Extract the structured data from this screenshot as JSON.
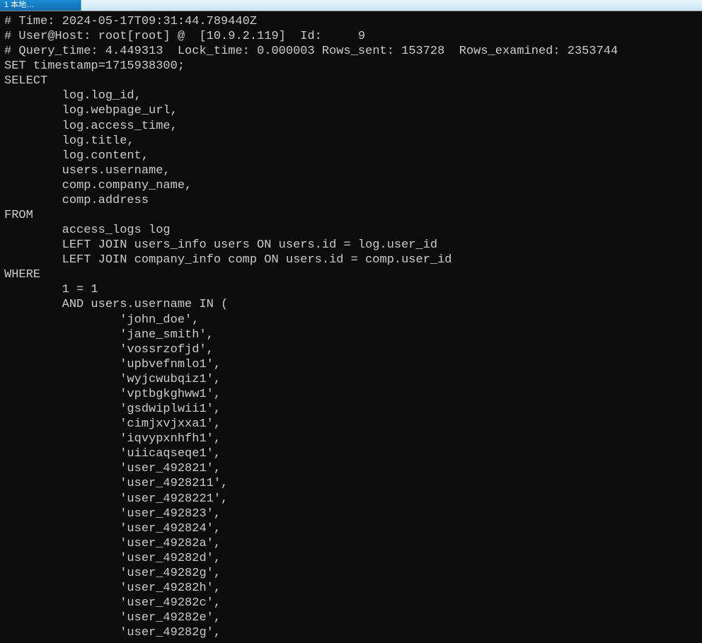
{
  "titlebar": {
    "label": "1 本地…"
  },
  "log": {
    "time_prefix": "# Time: ",
    "time_value": "2024-05-17T09:31:44.789440Z",
    "userhost_prefix": "# User@Host: ",
    "userhost_value": "root[root] @  [10.9.2.119]  Id:     9",
    "query_prefix": "# Query_time: ",
    "query_time": "4.449313",
    "lock_label": "  Lock_time: ",
    "lock_time": "0.000003",
    "rows_sent_label": " Rows_sent: ",
    "rows_sent": "153728",
    "rows_examined_label": "  Rows_examined: ",
    "rows_examined": "2353744",
    "set_stmt": "SET timestamp=1715938300;",
    "select_kw": "SELECT",
    "cols": [
      "        log.log_id,",
      "        log.webpage_url,",
      "        log.access_time,",
      "        log.title,",
      "        log.content,",
      "        users.username,",
      "        comp.company_name,",
      "        comp.address"
    ],
    "from_kw": "FROM",
    "from_lines": [
      "        access_logs log",
      "        LEFT JOIN users_info users ON users.id = log.user_id",
      "        LEFT JOIN company_info comp ON users.id = comp.user_id"
    ],
    "where_kw": "WHERE",
    "where_lines": [
      "        1 = 1",
      "        AND users.username IN (",
      "                'john_doe',",
      "                'jane_smith',",
      "                'vossrzofjd',",
      "                'upbvefnmlo1',",
      "                'wyjcwubqiz1',",
      "                'vptbgkghww1',",
      "                'gsdwiplwii1',",
      "                'cimjxvjxxa1',",
      "                'iqvypxnhfh1',",
      "                'uiicaqseqe1',",
      "                'user_492821',",
      "                'user_4928211',",
      "                'user_4928221',",
      "                'user_492823',",
      "                'user_492824',",
      "                'user_49282a',",
      "                'user_49282d',",
      "                'user_49282g',",
      "                'user_49282h',",
      "                'user_49282c',",
      "                'user_49282e',",
      "                'user_49282g',"
    ]
  }
}
